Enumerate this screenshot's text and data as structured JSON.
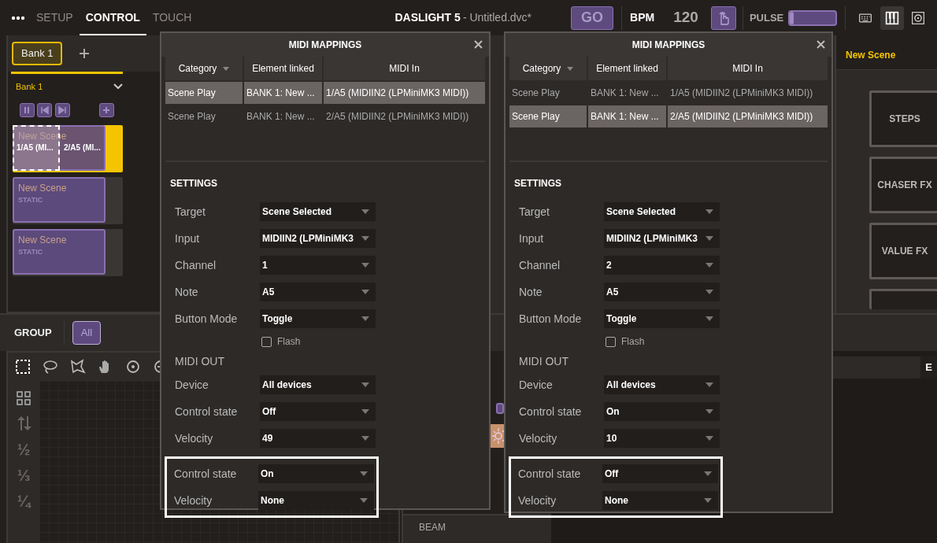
{
  "tabs": [
    {
      "label": "SETUP",
      "selected": false
    },
    {
      "label": "CONTROL",
      "selected": true
    },
    {
      "label": "TOUCH",
      "selected": false
    }
  ],
  "title": {
    "app": "DASLIGHT 5",
    "file": "- Untitled.dvc*"
  },
  "transport": {
    "go": "GO",
    "bpm_label": "BPM",
    "bpm": "120",
    "pulse_label": "PULSE",
    "pulse": {
      "level": 0.08
    }
  },
  "view_buttons": [
    {
      "kind": "keyboard",
      "selected": false
    },
    {
      "kind": "piano",
      "selected": true
    },
    {
      "kind": "speaker",
      "selected": false
    }
  ],
  "bank_tabs": [
    {
      "label": "Bank 1",
      "selected": true
    }
  ],
  "bank": {
    "title": "Bank 1",
    "scenes": [
      {
        "name": "New Scene",
        "selected": true,
        "mappings": [
          "1/A5 (MI...",
          "2/A5 (MI..."
        ]
      },
      {
        "name": "New Scene",
        "subtitle": "STATIC",
        "selected": false
      },
      {
        "name": "New Scene",
        "subtitle": "STATIC",
        "selected": false
      }
    ]
  },
  "right_panel": {
    "title": "New Scene",
    "buttons": [
      "STEPS",
      "CHASER FX",
      "VALUE FX"
    ]
  },
  "group": {
    "label": "GROUP",
    "filters": [
      {
        "label": "All",
        "selected": true
      }
    ]
  },
  "tool_fractions": [
    "½",
    "⅓",
    "¼"
  ],
  "beam_label": "BEAM",
  "lower_tab": "E",
  "dialogs": [
    {
      "title": "MIDI MAPPINGS",
      "columns": [
        "Category",
        "Element linked",
        "MIDI In"
      ],
      "rows": [
        {
          "category": "Scene Play",
          "element": "BANK 1: New ...",
          "midi_in": "1/A5 (MIDIIN2 (LPMiniMK3 MIDI))",
          "selected": true
        },
        {
          "category": "Scene Play",
          "element": "BANK 1: New ...",
          "midi_in": "2/A5 (MIDIIN2 (LPMiniMK3 MIDI))",
          "selected": false
        }
      ],
      "settings_title": "SETTINGS",
      "fields": [
        {
          "kind": "select",
          "label": "Target",
          "value": "Scene Selected"
        },
        {
          "kind": "select",
          "label": "Input",
          "value": "MIDIIN2 (LPMiniMK3"
        },
        {
          "kind": "select",
          "label": "Channel",
          "value": "1"
        },
        {
          "kind": "select",
          "label": "Note",
          "value": "A5"
        },
        {
          "kind": "select",
          "label": "Button Mode",
          "value": "Toggle"
        },
        {
          "kind": "checkbox",
          "label": "Flash",
          "checked": false
        },
        {
          "kind": "heading",
          "label": "MIDI OUT"
        },
        {
          "kind": "select",
          "label": "Device",
          "value": "All devices"
        },
        {
          "kind": "select",
          "label": "Control state",
          "value": "Off"
        },
        {
          "kind": "select",
          "label": "Velocity",
          "value": "49"
        }
      ],
      "framed_fields": [
        {
          "label": "Control state",
          "value": "On"
        },
        {
          "label": "Velocity",
          "value": "None"
        }
      ]
    },
    {
      "title": "MIDI MAPPINGS",
      "columns": [
        "Category",
        "Element linked",
        "MIDI In"
      ],
      "rows": [
        {
          "category": "Scene Play",
          "element": "BANK 1: New ...",
          "midi_in": "1/A5 (MIDIIN2 (LPMiniMK3 MIDI))",
          "selected": false
        },
        {
          "category": "Scene Play",
          "element": "BANK 1: New ...",
          "midi_in": "2/A5 (MIDIIN2 (LPMiniMK3 MIDI))",
          "selected": true
        }
      ],
      "settings_title": "SETTINGS",
      "fields": [
        {
          "kind": "select",
          "label": "Target",
          "value": "Scene Selected"
        },
        {
          "kind": "select",
          "label": "Input",
          "value": "MIDIIN2 (LPMiniMK3"
        },
        {
          "kind": "select",
          "label": "Channel",
          "value": "2"
        },
        {
          "kind": "select",
          "label": "Note",
          "value": "A5"
        },
        {
          "kind": "select",
          "label": "Button Mode",
          "value": "Toggle"
        },
        {
          "kind": "checkbox",
          "label": "Flash",
          "checked": false
        },
        {
          "kind": "heading",
          "label": "MIDI OUT"
        },
        {
          "kind": "select",
          "label": "Device",
          "value": "All devices"
        },
        {
          "kind": "select",
          "label": "Control state",
          "value": "On"
        },
        {
          "kind": "select",
          "label": "Velocity",
          "value": "10"
        }
      ],
      "framed_fields": [
        {
          "label": "Control state",
          "value": "Off"
        },
        {
          "label": "Velocity",
          "value": "None"
        }
      ]
    }
  ]
}
